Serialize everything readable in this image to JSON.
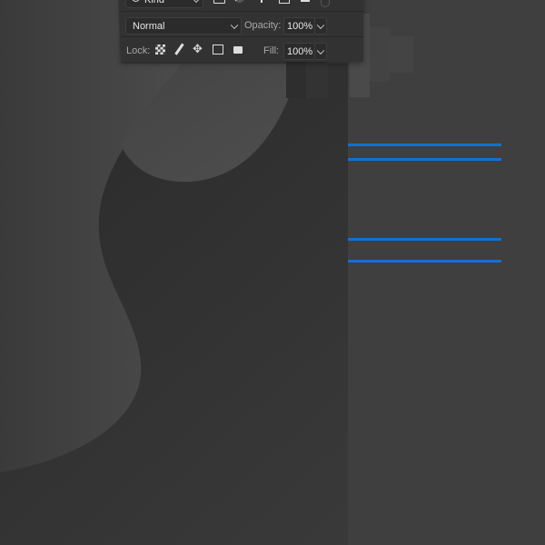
{
  "layers_panel": {
    "filter": {
      "label": "Kind",
      "icon": "search-icon"
    },
    "filter_icons": [
      "pixel-layer-filter-icon",
      "adjustment-layer-filter-icon",
      "type-layer-filter-icon",
      "shape-layer-filter-icon",
      "smart-object-filter-icon",
      "filter-toggle-icon"
    ],
    "blend_mode": "Normal",
    "opacity_label": "Opacity:",
    "opacity_value": "100%",
    "lock_label": "Lock:",
    "lock_icons": [
      "lock-transparent-pixels-icon",
      "lock-image-pixels-icon",
      "lock-position-icon",
      "lock-artboard-icon",
      "lock-all-icon"
    ],
    "fill_label": "Fill:",
    "fill_value": "100%"
  },
  "guides": {
    "color": "#1370d0",
    "count": 4
  }
}
